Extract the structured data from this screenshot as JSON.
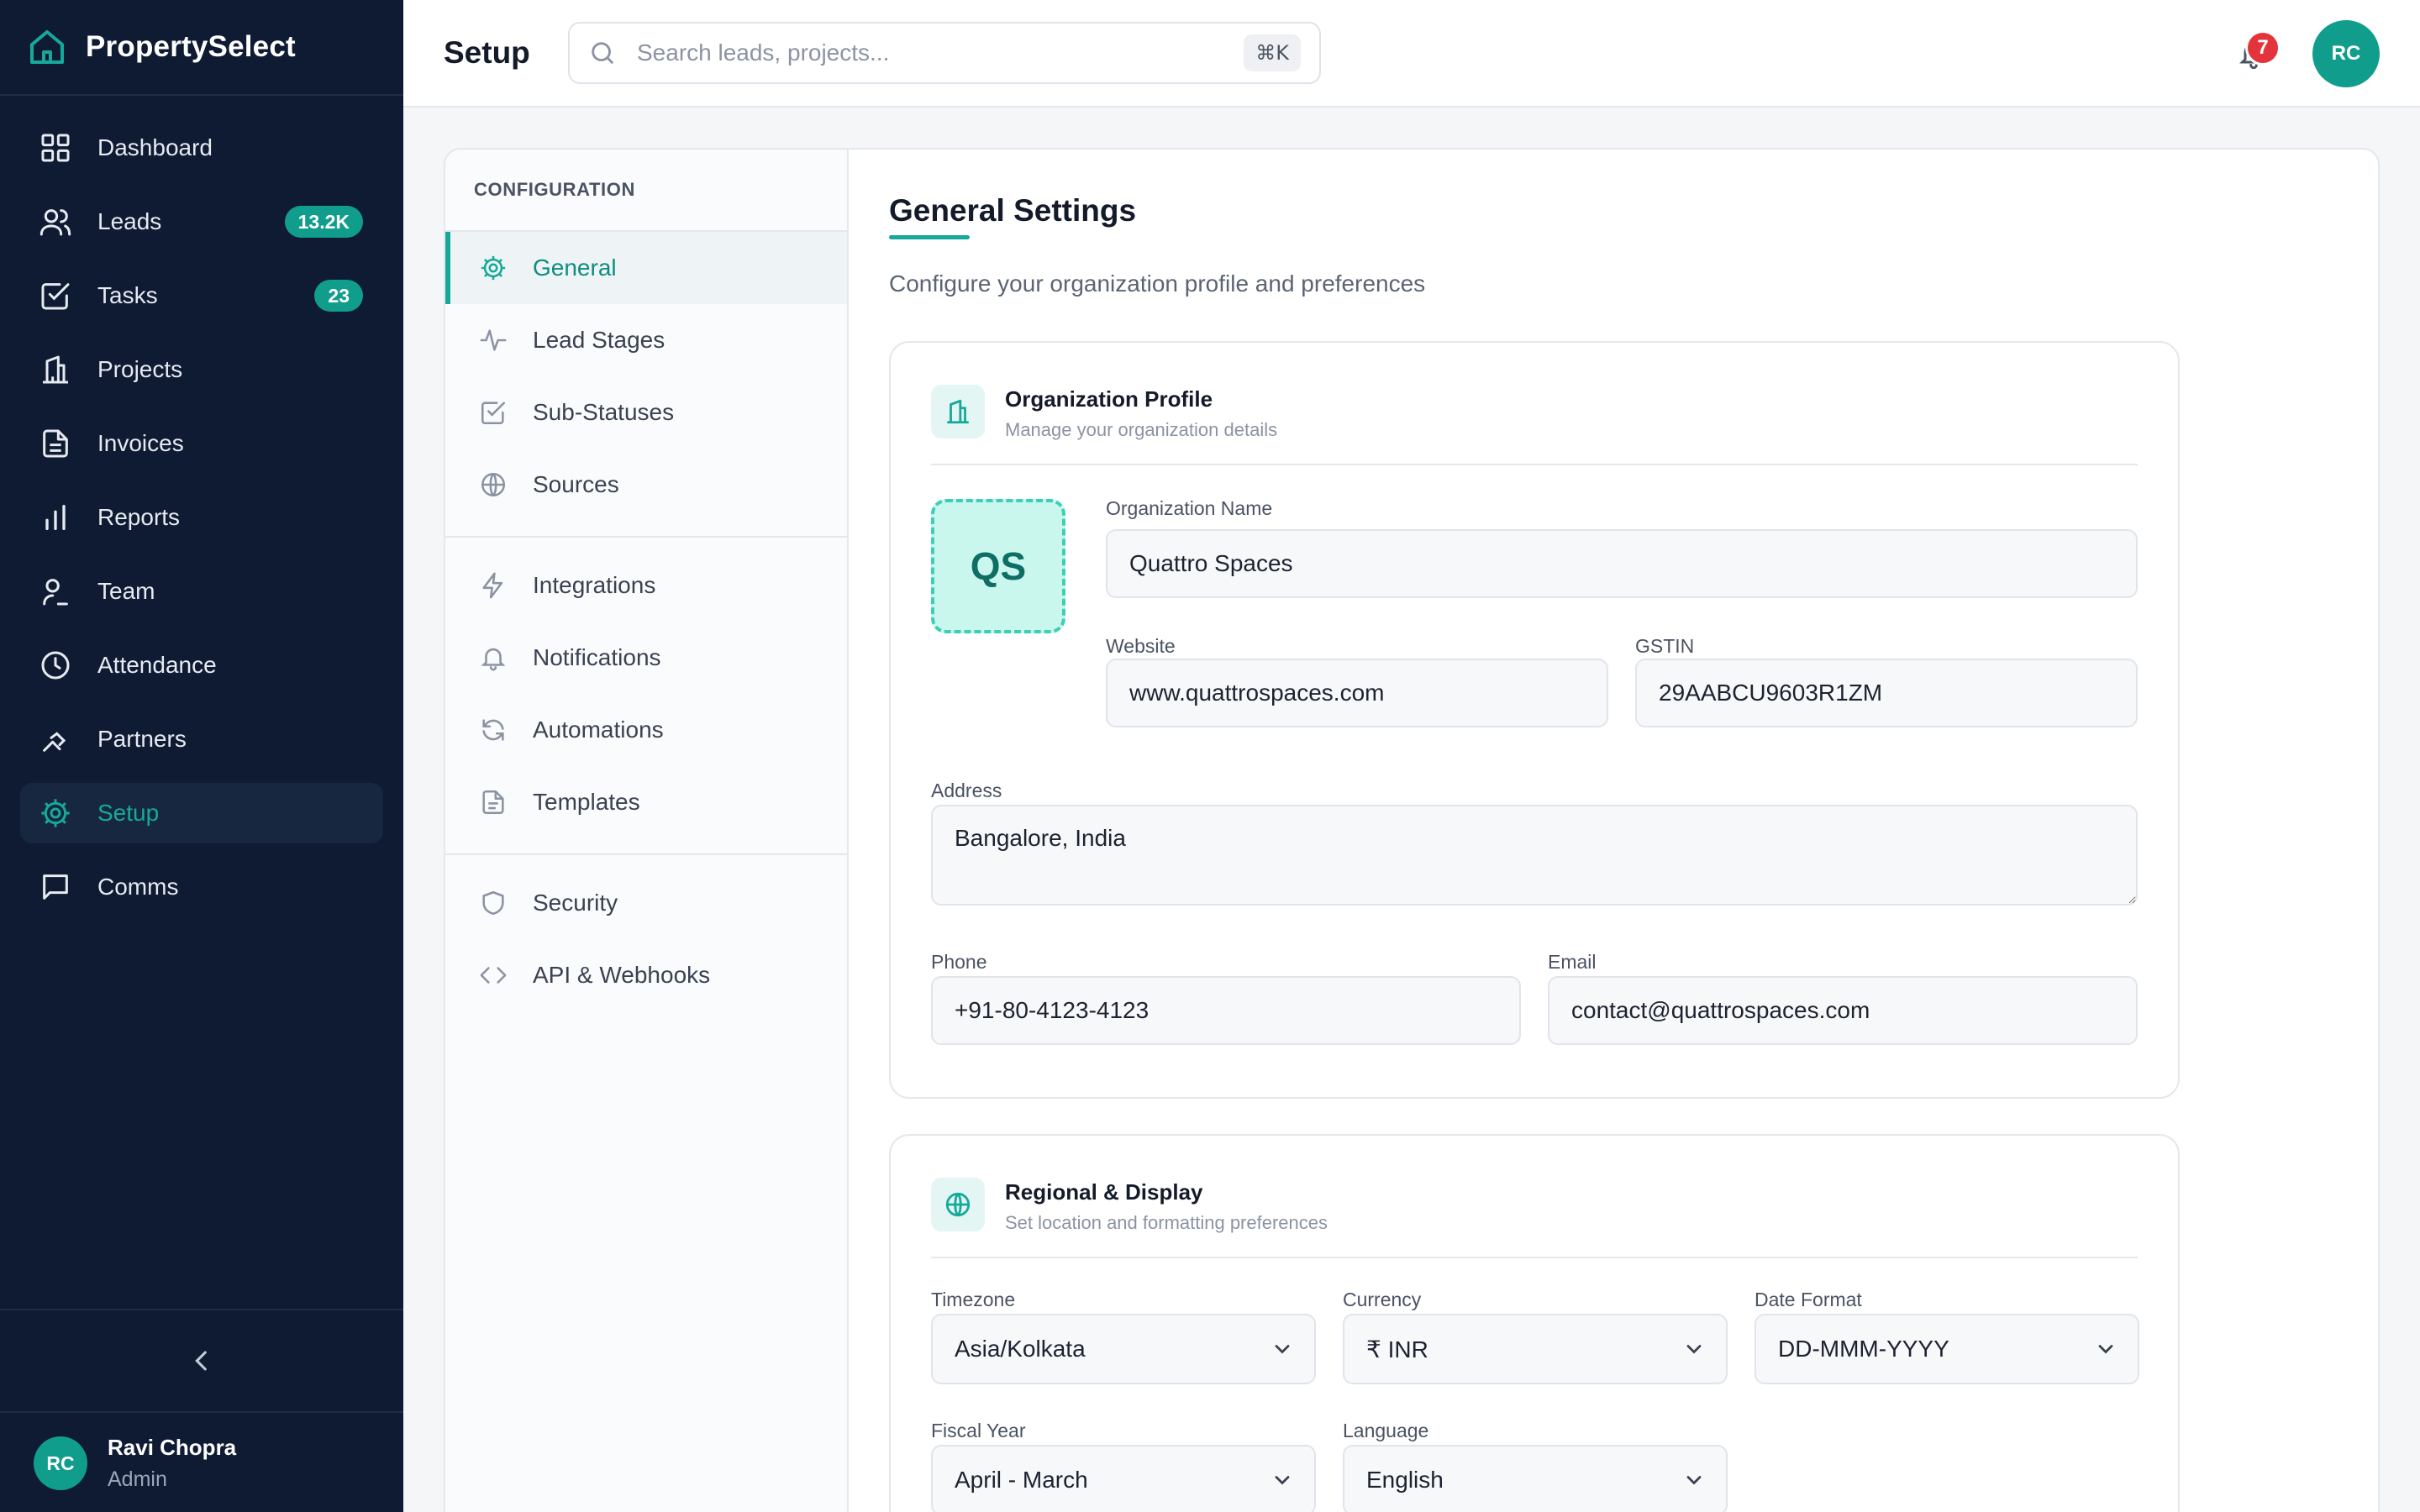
{
  "app": {
    "brand": "PropertySelect"
  },
  "sidebar": {
    "items": [
      {
        "label": "Dashboard",
        "icon": "grid-icon"
      },
      {
        "label": "Leads",
        "icon": "users-icon",
        "badge": "13.2K"
      },
      {
        "label": "Tasks",
        "icon": "check-square-icon",
        "badge": "23"
      },
      {
        "label": "Projects",
        "icon": "building-icon"
      },
      {
        "label": "Invoices",
        "icon": "file-text-icon"
      },
      {
        "label": "Reports",
        "icon": "bar-chart-icon"
      },
      {
        "label": "Team",
        "icon": "user-icon"
      },
      {
        "label": "Attendance",
        "icon": "clock-icon"
      },
      {
        "label": "Partners",
        "icon": "handshake-icon"
      },
      {
        "label": "Setup",
        "icon": "gear-icon",
        "active": true
      },
      {
        "label": "Comms",
        "icon": "message-icon"
      }
    ],
    "user": {
      "initials": "RC",
      "name": "Ravi Chopra",
      "role": "Admin"
    }
  },
  "topbar": {
    "title": "Setup",
    "search_placeholder": "Search leads, projects...",
    "shortcut": "⌘K",
    "notification_count": "7",
    "avatar_initials": "RC"
  },
  "config_nav": {
    "heading": "CONFIGURATION",
    "groups": [
      [
        {
          "label": "General",
          "icon": "gear-icon",
          "active": true
        },
        {
          "label": "Lead Stages",
          "icon": "activity-icon"
        },
        {
          "label": "Sub-Statuses",
          "icon": "check-square-icon"
        },
        {
          "label": "Sources",
          "icon": "globe-icon"
        }
      ],
      [
        {
          "label": "Integrations",
          "icon": "zap-icon"
        },
        {
          "label": "Notifications",
          "icon": "bell-icon"
        },
        {
          "label": "Automations",
          "icon": "refresh-icon"
        },
        {
          "label": "Templates",
          "icon": "file-icon"
        }
      ],
      [
        {
          "label": "Security",
          "icon": "shield-icon"
        },
        {
          "label": "API & Webhooks",
          "icon": "code-icon"
        }
      ]
    ]
  },
  "general": {
    "title": "General Settings",
    "subtitle": "Configure your organization profile and preferences"
  },
  "org_profile": {
    "title": "Organization Profile",
    "description": "Manage your organization details",
    "logo_initials": "QS",
    "fields": {
      "org_name": {
        "label": "Organization Name",
        "value": "Quattro Spaces"
      },
      "website": {
        "label": "Website",
        "value": "www.quattrospaces.com"
      },
      "gstin": {
        "label": "GSTIN",
        "value": "29AABCU9603R1ZM"
      },
      "address": {
        "label": "Address",
        "value": "Bangalore, India"
      },
      "phone": {
        "label": "Phone",
        "value": "+91-80-4123-4123"
      },
      "email": {
        "label": "Email",
        "value": "contact@quattrospaces.com"
      }
    }
  },
  "regional": {
    "title": "Regional & Display",
    "description": "Set location and formatting preferences",
    "fields": {
      "timezone": {
        "label": "Timezone",
        "value": "Asia/Kolkata"
      },
      "currency": {
        "label": "Currency",
        "value": "₹ INR"
      },
      "date_format": {
        "label": "Date Format",
        "value": "DD-MMM-YYYY"
      },
      "fiscal_year": {
        "label": "Fiscal Year",
        "value": "April - March"
      },
      "language": {
        "label": "Language",
        "value": "English"
      }
    }
  },
  "colors": {
    "sidebar_bg": "#0f1b33",
    "accent": "#16a99a",
    "badge_red": "#e3343b"
  }
}
